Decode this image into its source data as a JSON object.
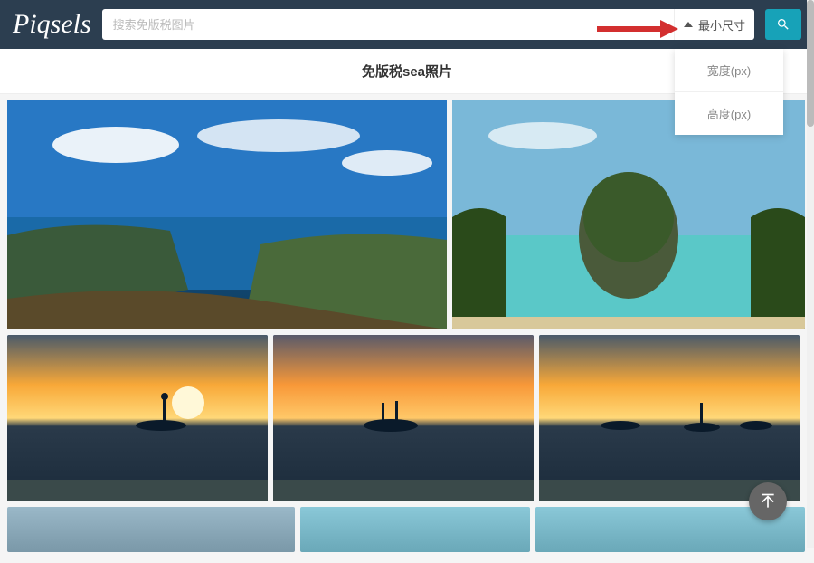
{
  "brand": "Piqsels",
  "search": {
    "placeholder": "搜索免版税图片",
    "size_label": "最小尺寸"
  },
  "title": "免版税sea照片",
  "dropdown": {
    "width_label": "宽度(px)",
    "height_label": "高度(px)"
  }
}
